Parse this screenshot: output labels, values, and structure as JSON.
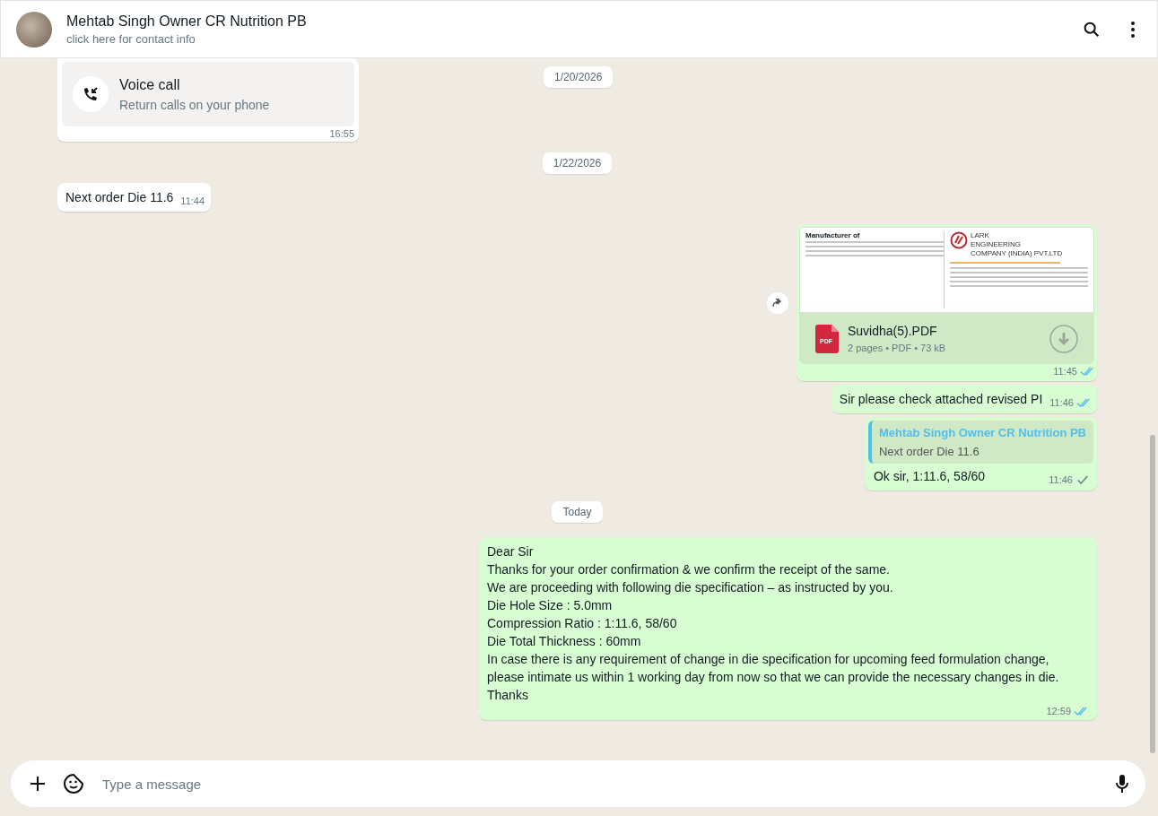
{
  "header": {
    "name": "Mehtab Singh Owner CR Nutrition PB",
    "subtitle": "click here for contact info"
  },
  "sticky_date": "1/20/2026",
  "messages": [
    {
      "kind": "call",
      "outgoing": false,
      "title": "Voice call",
      "subtitle": "Return calls on your phone",
      "time": "16:55"
    },
    {
      "kind": "date",
      "text": "1/22/2026"
    },
    {
      "kind": "text",
      "outgoing": false,
      "text": "Next order Die 11.6",
      "time": "11:44"
    },
    {
      "kind": "document",
      "outgoing": true,
      "preview": {
        "left_heading": "Manufacturer of",
        "company": [
          "LARK",
          "ENGINEERING",
          "COMPANY (INDIA) PVT.LTD"
        ]
      },
      "file_name": "Suvidha(5).PDF",
      "file_type": "PDF",
      "file_info": "2 pages • PDF • 73 kB",
      "time": "11:45",
      "read": true
    },
    {
      "kind": "text",
      "outgoing": true,
      "text": "Sir please check attached revised PI",
      "time": "11:46",
      "read": true
    },
    {
      "kind": "reply",
      "outgoing": true,
      "quote_author": "Mehtab Singh Owner CR Nutrition PB",
      "quote_text": "Next order Die 11.6",
      "text": "Ok sir, 1:11.6, 58/60",
      "time": "11:46",
      "read": false
    },
    {
      "kind": "date",
      "text": "Today"
    },
    {
      "kind": "multiline",
      "outgoing": true,
      "lines": [
        "Dear Sir",
        "Thanks for your order confirmation & we confirm the receipt of the same.",
        "We are proceeding with following die specification – as instructed by you.",
        "Die Hole Size : 5.0mm",
        "Compression Ratio : 1:11.6, 58/60",
        "Die Total Thickness : 60mm",
        "In case there is any requirement of change in die specification for upcoming feed formulation change, please intimate us within 1 working day from now so that we can provide the necessary changes in die.",
        "Thanks"
      ],
      "time": "12:59",
      "read": true
    }
  ],
  "composer": {
    "placeholder": "Type a message"
  }
}
